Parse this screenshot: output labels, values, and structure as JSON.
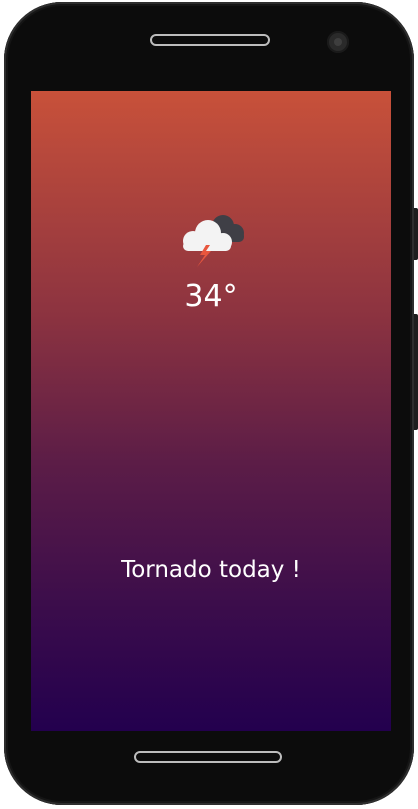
{
  "weather": {
    "icon": "thunderstorm-cloud-icon",
    "temperature": "34°",
    "message": "Tornado today !"
  },
  "colors": {
    "gradient_top": "#c8513a",
    "gradient_bottom": "#23004e",
    "text": "#ffffff",
    "lightning": "#e8563e"
  }
}
